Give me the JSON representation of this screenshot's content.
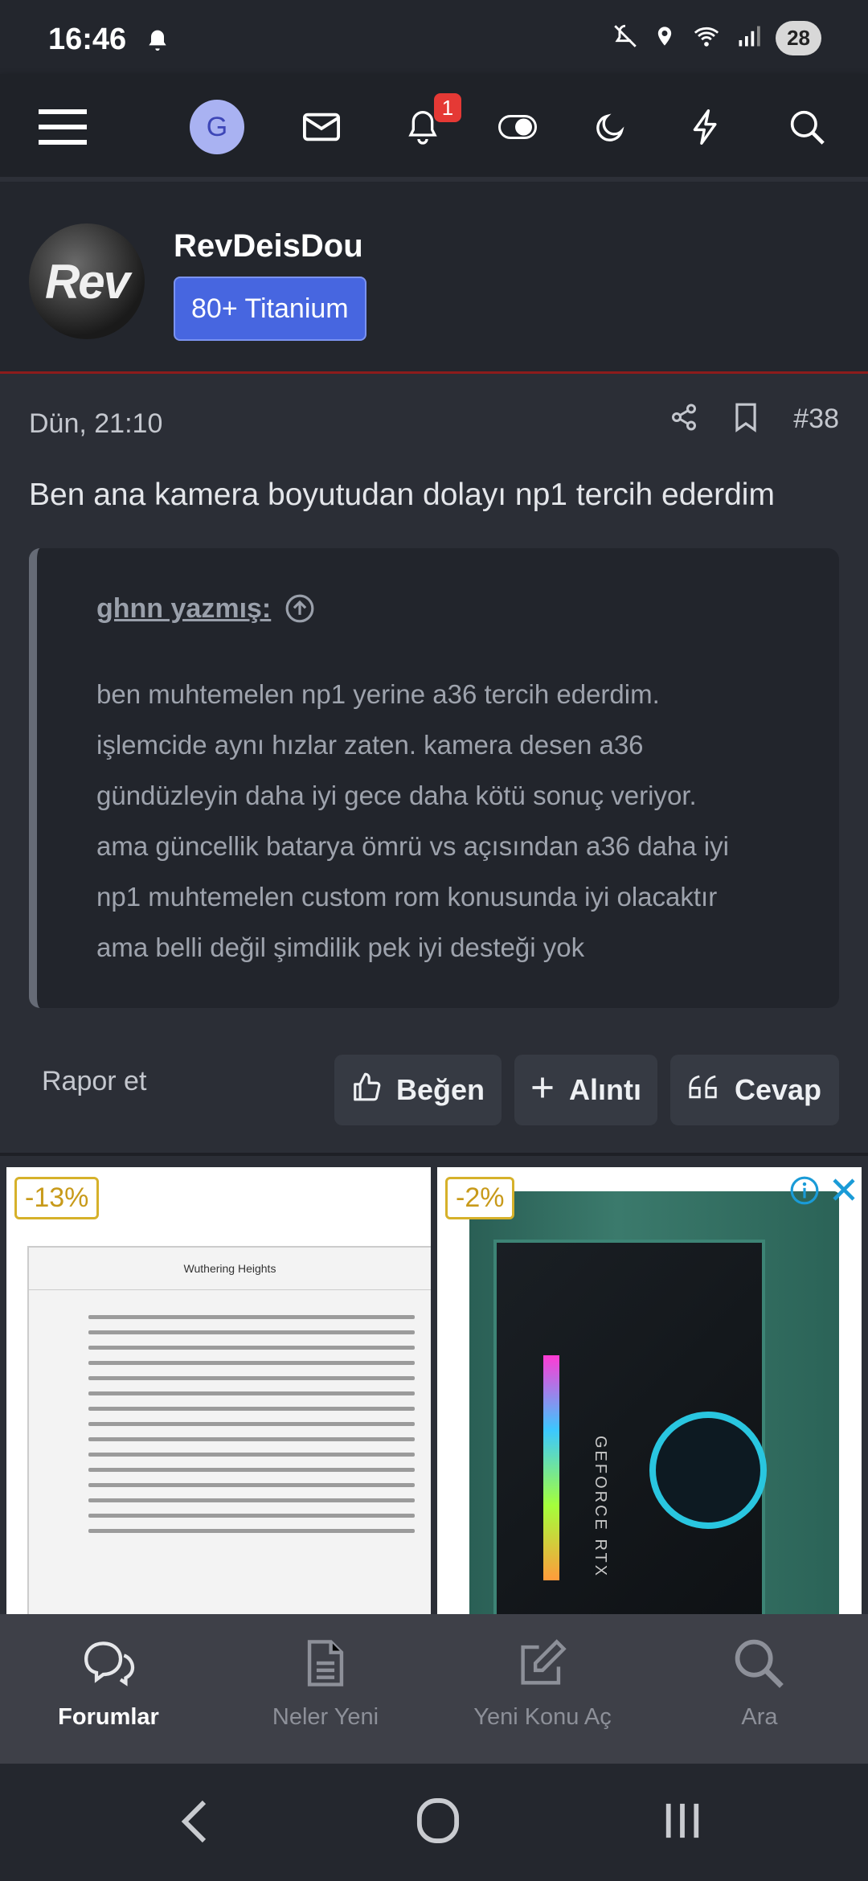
{
  "status_bar": {
    "time": "16:46",
    "battery": "28"
  },
  "top_nav": {
    "avatar_letter": "G",
    "notification_count": "1"
  },
  "user": {
    "name": "RevDeisDou",
    "avatar_text": "Rev",
    "title": "80+ Titanium"
  },
  "post": {
    "date": "Dün, 21:10",
    "number": "#38",
    "body": "Ben ana kamera boyutudan dolayı np1 tercih ederdim",
    "quote": {
      "author": "ghnn yazmış:",
      "lines": [
        "ben muhtemelen np1 yerine a36 tercih ederdim.",
        "işlemcide aynı hızlar zaten. kamera desen a36",
        "gündüzleyin daha iyi gece daha kötü sonuç veriyor.",
        "ama güncellik batarya ömrü vs açısından a36 daha iyi",
        "np1 muhtemelen custom rom konusunda iyi olacaktır",
        "ama belli değil şimdilik pek iyi desteği yok"
      ]
    },
    "report_label": "Rapor et",
    "like_label": "Beğen",
    "quote_label": "Alıntı",
    "reply_label": "Cevap"
  },
  "ads": [
    {
      "discount": "-13%",
      "book_title": "Wuthering Heights"
    },
    {
      "discount": "-2%",
      "gpu_text": "GEFORCE RTX"
    }
  ],
  "bottom_nav": [
    {
      "label": "Forumlar",
      "icon": "chat-bubbles-icon"
    },
    {
      "label": "Neler Yeni",
      "icon": "document-icon"
    },
    {
      "label": "Yeni Konu Aç",
      "icon": "edit-icon"
    },
    {
      "label": "Ara",
      "icon": "search-icon"
    }
  ],
  "colors": {
    "accent": "#4766e0",
    "badge": "#e53935",
    "background": "#2b2e36"
  }
}
